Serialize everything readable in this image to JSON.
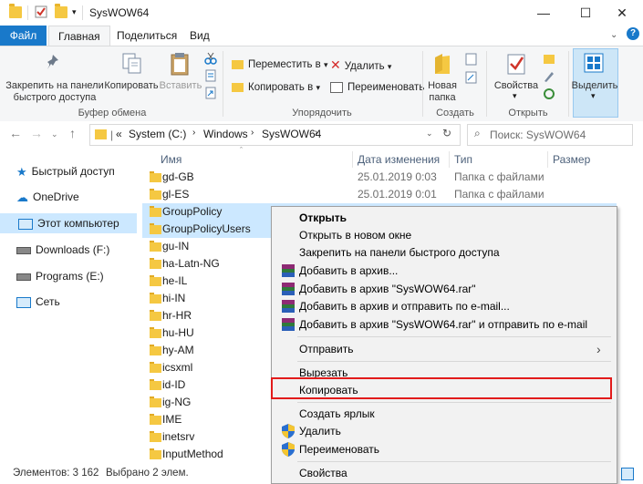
{
  "window": {
    "title": "SysWOW64",
    "minimize": "—",
    "maximize": "☐",
    "close": "✕"
  },
  "tabs": [
    "Файл",
    "Главная",
    "Поделиться",
    "Вид"
  ],
  "ribbon": {
    "pin": "Закрепить на панели быстрого доступа",
    "copy": "Копировать",
    "paste": "Вставить",
    "clipboard_group": "Буфер обмена",
    "move_to": "Переместить в",
    "copy_to": "Копировать в",
    "delete": "Удалить",
    "rename": "Переименовать",
    "organize_group": "Упорядочить",
    "new_folder": "Новая папка",
    "create_group": "Создать",
    "properties": "Свойства",
    "open_group": "Открыть",
    "select": "Выделить"
  },
  "address": {
    "crumbs": [
      "«",
      "System (C:)",
      "Windows",
      "SysWOW64"
    ],
    "search_placeholder": "Поиск: SysWOW64"
  },
  "nav": [
    {
      "label": "Быстрый доступ",
      "icon": "star-icon"
    },
    {
      "label": "OneDrive",
      "icon": "cloud-icon"
    },
    {
      "label": "Этот компьютер",
      "icon": "computer-icon",
      "selected": true
    },
    {
      "label": "Downloads (F:)",
      "icon": "drive-icon"
    },
    {
      "label": "Programs (E:)",
      "icon": "drive-icon"
    },
    {
      "label": "Сеть",
      "icon": "network-icon"
    }
  ],
  "columns": [
    "Имя",
    "Дата изменения",
    "Тип",
    "Размер"
  ],
  "files": [
    {
      "name": "gd-GB",
      "date": "25.01.2019 0:03",
      "type": "Папка с файлами"
    },
    {
      "name": "gl-ES",
      "date": "25.01.2019 0:01",
      "type": "Папка с файлами"
    },
    {
      "name": "GroupPolicy",
      "selected": true
    },
    {
      "name": "GroupPolicyUsers",
      "selected": true
    },
    {
      "name": "gu-IN"
    },
    {
      "name": "ha-Latn-NG"
    },
    {
      "name": "he-IL"
    },
    {
      "name": "hi-IN"
    },
    {
      "name": "hr-HR"
    },
    {
      "name": "hu-HU"
    },
    {
      "name": "hy-AM"
    },
    {
      "name": "icsxml"
    },
    {
      "name": "id-ID"
    },
    {
      "name": "ig-NG"
    },
    {
      "name": "IME"
    },
    {
      "name": "inetsrv"
    },
    {
      "name": "InputMethod"
    }
  ],
  "context_menu": {
    "open": "Открыть",
    "open_new_window": "Открыть в новом окне",
    "pin_quick": "Закрепить на панели быстрого доступа",
    "add_archive": "Добавить в архив...",
    "add_rar": "Добавить в архив \"SysWOW64.rar\"",
    "add_email": "Добавить в архив и отправить по e-mail...",
    "add_rar_email": "Добавить в архив \"SysWOW64.rar\" и отправить по e-mail",
    "send_to": "Отправить",
    "cut": "Вырезать",
    "copy": "Копировать",
    "create_shortcut": "Создать ярлык",
    "delete": "Удалить",
    "rename": "Переименовать",
    "properties": "Свойства"
  },
  "status": {
    "count": "Элементов: 3 162",
    "selected": "Выбрано 2 элем."
  },
  "colors": {
    "accent": "#1979ca",
    "selection": "#cce8ff",
    "highlight_box": "#e21b1b"
  }
}
